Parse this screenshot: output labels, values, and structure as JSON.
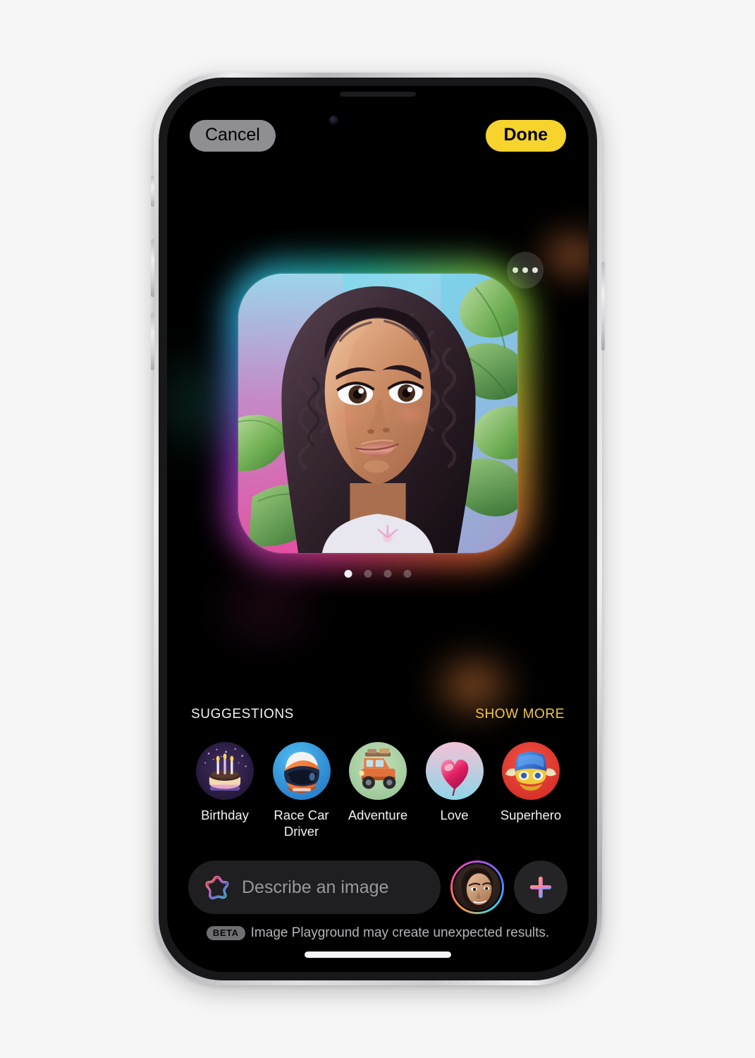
{
  "app": {
    "name": "Image Playground"
  },
  "topbar": {
    "cancel_label": "Cancel",
    "done_label": "Done"
  },
  "canvas": {
    "more_button_name": "more-options",
    "image_alt": "Generated illustrated portrait of a smiling young woman with long curly dark hair surrounded by green tropical leaves on a blue-pink gradient background",
    "pagination": {
      "total": 4,
      "active_index": 0
    }
  },
  "suggestions": {
    "title": "SUGGESTIONS",
    "show_more_label": "SHOW MORE",
    "accent_color": "#f2c93a",
    "items": [
      {
        "label": "Birthday",
        "icon": "birthday-cake-icon",
        "bg": "#2c2140"
      },
      {
        "label": "Race Car Driver",
        "icon": "racing-helmet-icon",
        "bg": "#2e9ae0"
      },
      {
        "label": "Adventure",
        "icon": "off-road-truck-icon",
        "bg": "#a8cfa6"
      },
      {
        "label": "Love",
        "icon": "heart-balloon-icon",
        "bg": "#9fd8e8"
      },
      {
        "label": "Superhero",
        "icon": "superhero-mask-icon",
        "bg": "#e33b31"
      }
    ]
  },
  "composer": {
    "icon": "apple-intelligence-icon",
    "placeholder": "Describe an image",
    "value": "",
    "avatar_name": "person-avatar",
    "add_button_icon": "plus-icon"
  },
  "footer": {
    "badge": "BETA",
    "disclaimer": "Image Playground may create unexpected results."
  },
  "device": {
    "home_indicator": "home-indicator"
  }
}
